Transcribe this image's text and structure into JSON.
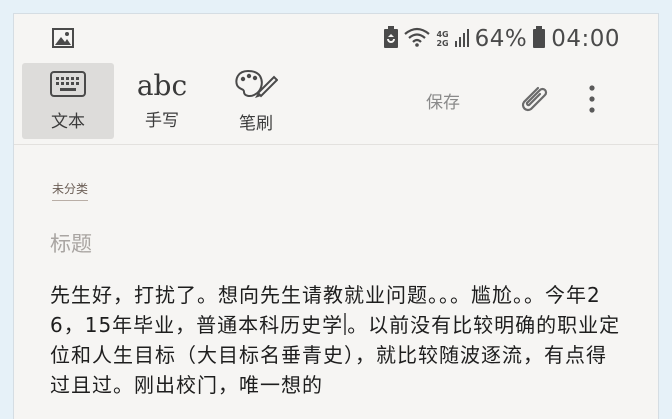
{
  "status_bar": {
    "gallery_icon": "image-icon",
    "battery_saver_icon": "battery-recycle-icon",
    "wifi_icon": "wifi-icon",
    "network": [
      "4G",
      "2G"
    ],
    "signal_icon": "signal-bars-icon",
    "battery_percent": "64%",
    "battery_icon": "battery-icon",
    "time": "04:00"
  },
  "toolbar": {
    "modes": [
      {
        "label": "文本",
        "icon": "keyboard-icon",
        "active": true
      },
      {
        "label": "手写",
        "icon": "abc-handwriting-icon",
        "glyph": "abc",
        "active": false
      },
      {
        "label": "笔刷",
        "icon": "palette-brush-icon",
        "active": false
      }
    ],
    "save_label": "保存",
    "attach_icon": "paperclip-icon",
    "more_icon": "more-vertical-icon"
  },
  "note": {
    "category": "未分类",
    "title_placeholder": "标题",
    "body_before_cursor": "先生好，打扰了。想向先生请教就业问题。。。尴尬。。今年26，15年毕业，普通本科历史学",
    "body_after_cursor": "。以前没有比较明确的职业定位和人生目标（大目标名垂青史），就比较随波逐流，有点得过且过。刚出校门，唯一想的"
  },
  "colors": {
    "background": "#f6f5f3",
    "active_tab": "#dddcda",
    "text": "#1e1e1e",
    "placeholder": "#a9a5a2"
  }
}
